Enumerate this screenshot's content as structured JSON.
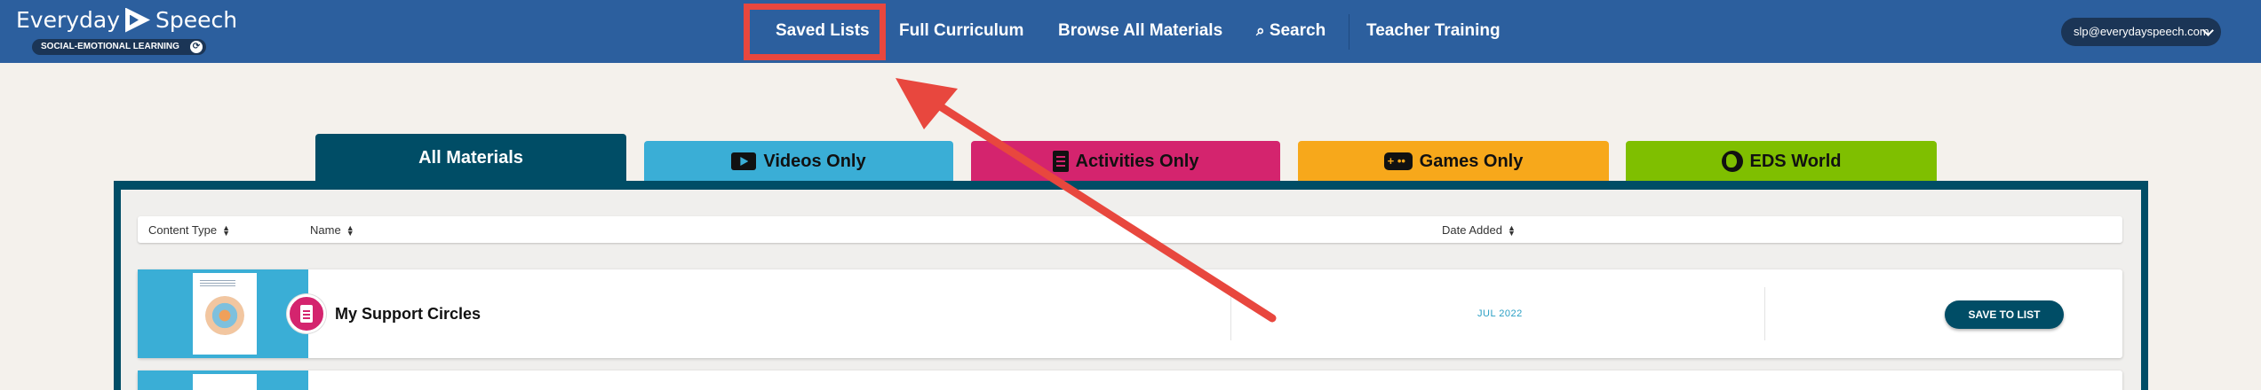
{
  "header": {
    "logo_text_left": "Everyday",
    "logo_text_right": "Speech",
    "logo_badge": "SOCIAL-EMOTIONAL LEARNING",
    "nav": [
      {
        "label": "Saved Lists"
      },
      {
        "label": "Full Curriculum"
      },
      {
        "label": "Browse All Materials"
      },
      {
        "label": "Search",
        "icon": "search-icon"
      },
      {
        "label": "Teacher Training"
      }
    ],
    "account_email": "slp@everydayspeech.com"
  },
  "tabs": [
    {
      "label": "All Materials",
      "active": true,
      "color": "#004d66"
    },
    {
      "label": "Videos Only",
      "icon": "video-icon",
      "color": "#3aaed6"
    },
    {
      "label": "Activities Only",
      "icon": "activity-icon",
      "color": "#d4246e"
    },
    {
      "label": "Games Only",
      "icon": "gamepad-icon",
      "color": "#f7a81b"
    },
    {
      "label": "EDS World",
      "icon": "globe-icon",
      "color": "#7fbf00"
    }
  ],
  "table": {
    "columns": [
      {
        "label": "Content Type"
      },
      {
        "label": "Name"
      },
      {
        "label": "Date Added"
      }
    ],
    "rows": [
      {
        "title": "My Support Circles",
        "date": "JUL 2022",
        "action": "SAVE TO LIST",
        "type": "activity"
      }
    ]
  },
  "annotation": {
    "color": "#e8473e",
    "target": "Saved Lists"
  }
}
